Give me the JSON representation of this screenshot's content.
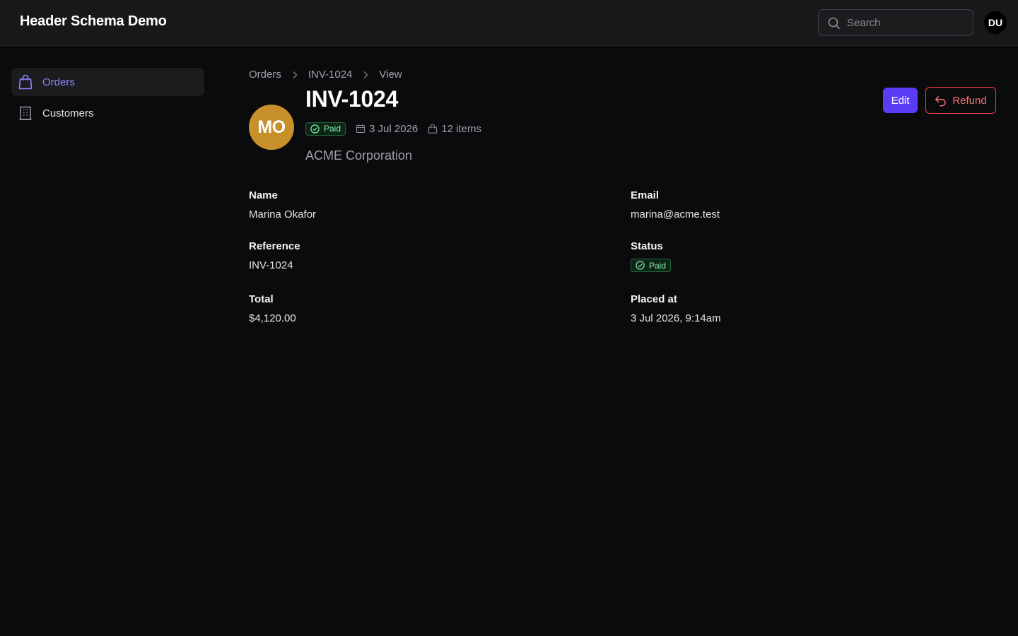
{
  "app": {
    "title": "Header Schema Demo"
  },
  "search": {
    "placeholder": "Search"
  },
  "user": {
    "initials": "DU"
  },
  "sidebar": {
    "items": [
      {
        "label": "Orders",
        "icon": "shopping-bag-icon",
        "active": true
      },
      {
        "label": "Customers",
        "icon": "building-icon",
        "active": false
      }
    ]
  },
  "breadcrumb": [
    "Orders",
    "INV-1024",
    "View"
  ],
  "record": {
    "initials": "MO",
    "title": "INV-1024",
    "status": "Paid",
    "date": "3 Jul 2026",
    "items": "12 items",
    "subtitle": "ACME Corporation"
  },
  "actions": {
    "edit": "Edit",
    "refund": "Refund"
  },
  "fields": {
    "name": {
      "label": "Name",
      "value": "Marina Okafor"
    },
    "email": {
      "label": "Email",
      "value": "marina@acme.test"
    },
    "reference": {
      "label": "Reference",
      "value": "INV-1024"
    },
    "status": {
      "label": "Status",
      "value": "Paid"
    },
    "total": {
      "label": "Total",
      "value": "$4,120.00"
    },
    "placed_at": {
      "label": "Placed at",
      "value": "3 Jul 2026, 9:14am"
    }
  },
  "colors": {
    "accent": "#5b3cf5",
    "active_nav": "#8b86ff",
    "danger": "#ef4444",
    "success": "#86efac",
    "avatar": "#c8902a"
  }
}
